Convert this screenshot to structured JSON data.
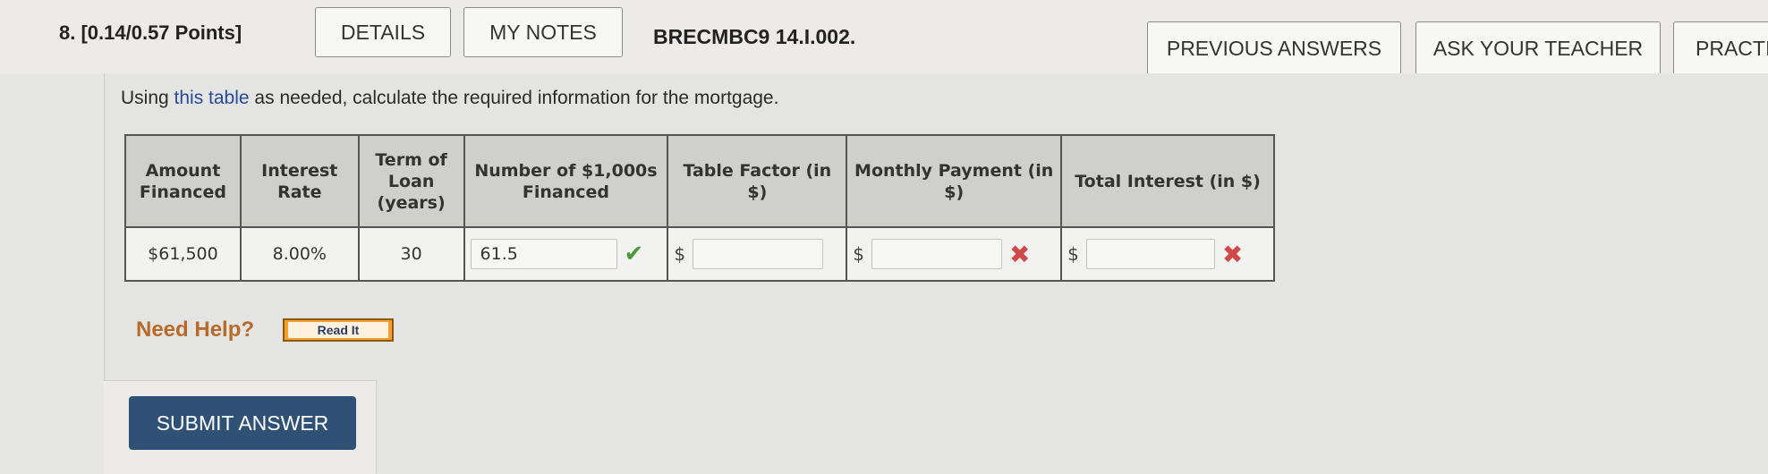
{
  "question": {
    "number_points": "8. [0.14/0.57 Points]",
    "code": "BRECMBC9 14.I.002."
  },
  "buttons": {
    "details": "DETAILS",
    "my_notes": "MY NOTES",
    "previous_answers": "PREVIOUS ANSWERS",
    "ask_teacher": "ASK YOUR TEACHER",
    "practice": "PRACTI",
    "submit": "SUBMIT ANSWER",
    "read_it": "Read It"
  },
  "instructions": {
    "prefix": "Using ",
    "link": "this table",
    "suffix": " as needed, calculate the required information for the mortgage."
  },
  "table": {
    "headers": {
      "amount": "Amount Financed",
      "rate": "Interest Rate",
      "term": "Term of Loan (years)",
      "number": "Number of $1,000s Financed",
      "factor": "Table Factor (in $)",
      "payment": "Monthly Payment (in $)",
      "interest": "Total Interest (in $)"
    },
    "row": {
      "amount": "$61,500",
      "rate": "8.00%",
      "term": "30",
      "number_value": "61.5",
      "factor_prefix": "$",
      "factor_value": "",
      "payment_prefix": "$",
      "payment_value": "",
      "interest_prefix": "$",
      "interest_value": ""
    },
    "status": {
      "number": "correct",
      "payment": "incorrect",
      "interest": "incorrect"
    }
  },
  "help": {
    "label": "Need Help?"
  },
  "colors": {
    "submit_bg": "#2f5175",
    "correct": "#4a9a3a",
    "incorrect": "#d04848",
    "help_text": "#b86a2a"
  }
}
